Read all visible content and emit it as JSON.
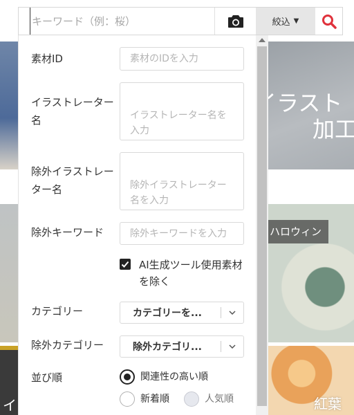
{
  "search": {
    "placeholder": "キーワード（例：桜）",
    "filter_label": "絞込",
    "filter_arrow": "▼"
  },
  "background": {
    "banner_text_line1": "イラスト",
    "banner_text_line2": "加工",
    "tag_halloween": "ハロウィン",
    "left_bottom_text": "イ",
    "right_bottom_text": "紅葉"
  },
  "panel": {
    "material_id": {
      "label": "素材ID",
      "placeholder": "素材のIDを入力"
    },
    "illustrator": {
      "label": "イラストレーター名",
      "placeholder": "イラストレーター名を入力"
    },
    "exclude_illustrator": {
      "label": "除外イラストレーター名",
      "placeholder": "除外イラストレーター名を入力"
    },
    "exclude_keyword": {
      "label": "除外キーワード",
      "placeholder": "除外キーワードを入力"
    },
    "exclude_ai": {
      "label": "AI生成ツール使用素材を除く",
      "checked": true
    },
    "category": {
      "label": "カテゴリー",
      "value": "カテゴリーを..."
    },
    "exclude_category": {
      "label": "除外カテゴリー",
      "value": "除外カテゴリ..."
    },
    "sort": {
      "label": "並び順",
      "options": [
        {
          "label": "関連性の高い順",
          "selected": true,
          "disabled": false
        },
        {
          "label": "新着順",
          "selected": false,
          "disabled": false
        },
        {
          "label": "人気順",
          "selected": false,
          "disabled": true
        }
      ]
    }
  },
  "colors": {
    "accent_search": "#e0323c",
    "filter_bg": "#e6e6e6",
    "checkbox": "#222222"
  },
  "icons": {
    "camera": "camera-icon",
    "search": "search-icon",
    "chevron": "chevron-down-icon",
    "scroll_up": "scroll-up-arrow-icon"
  }
}
